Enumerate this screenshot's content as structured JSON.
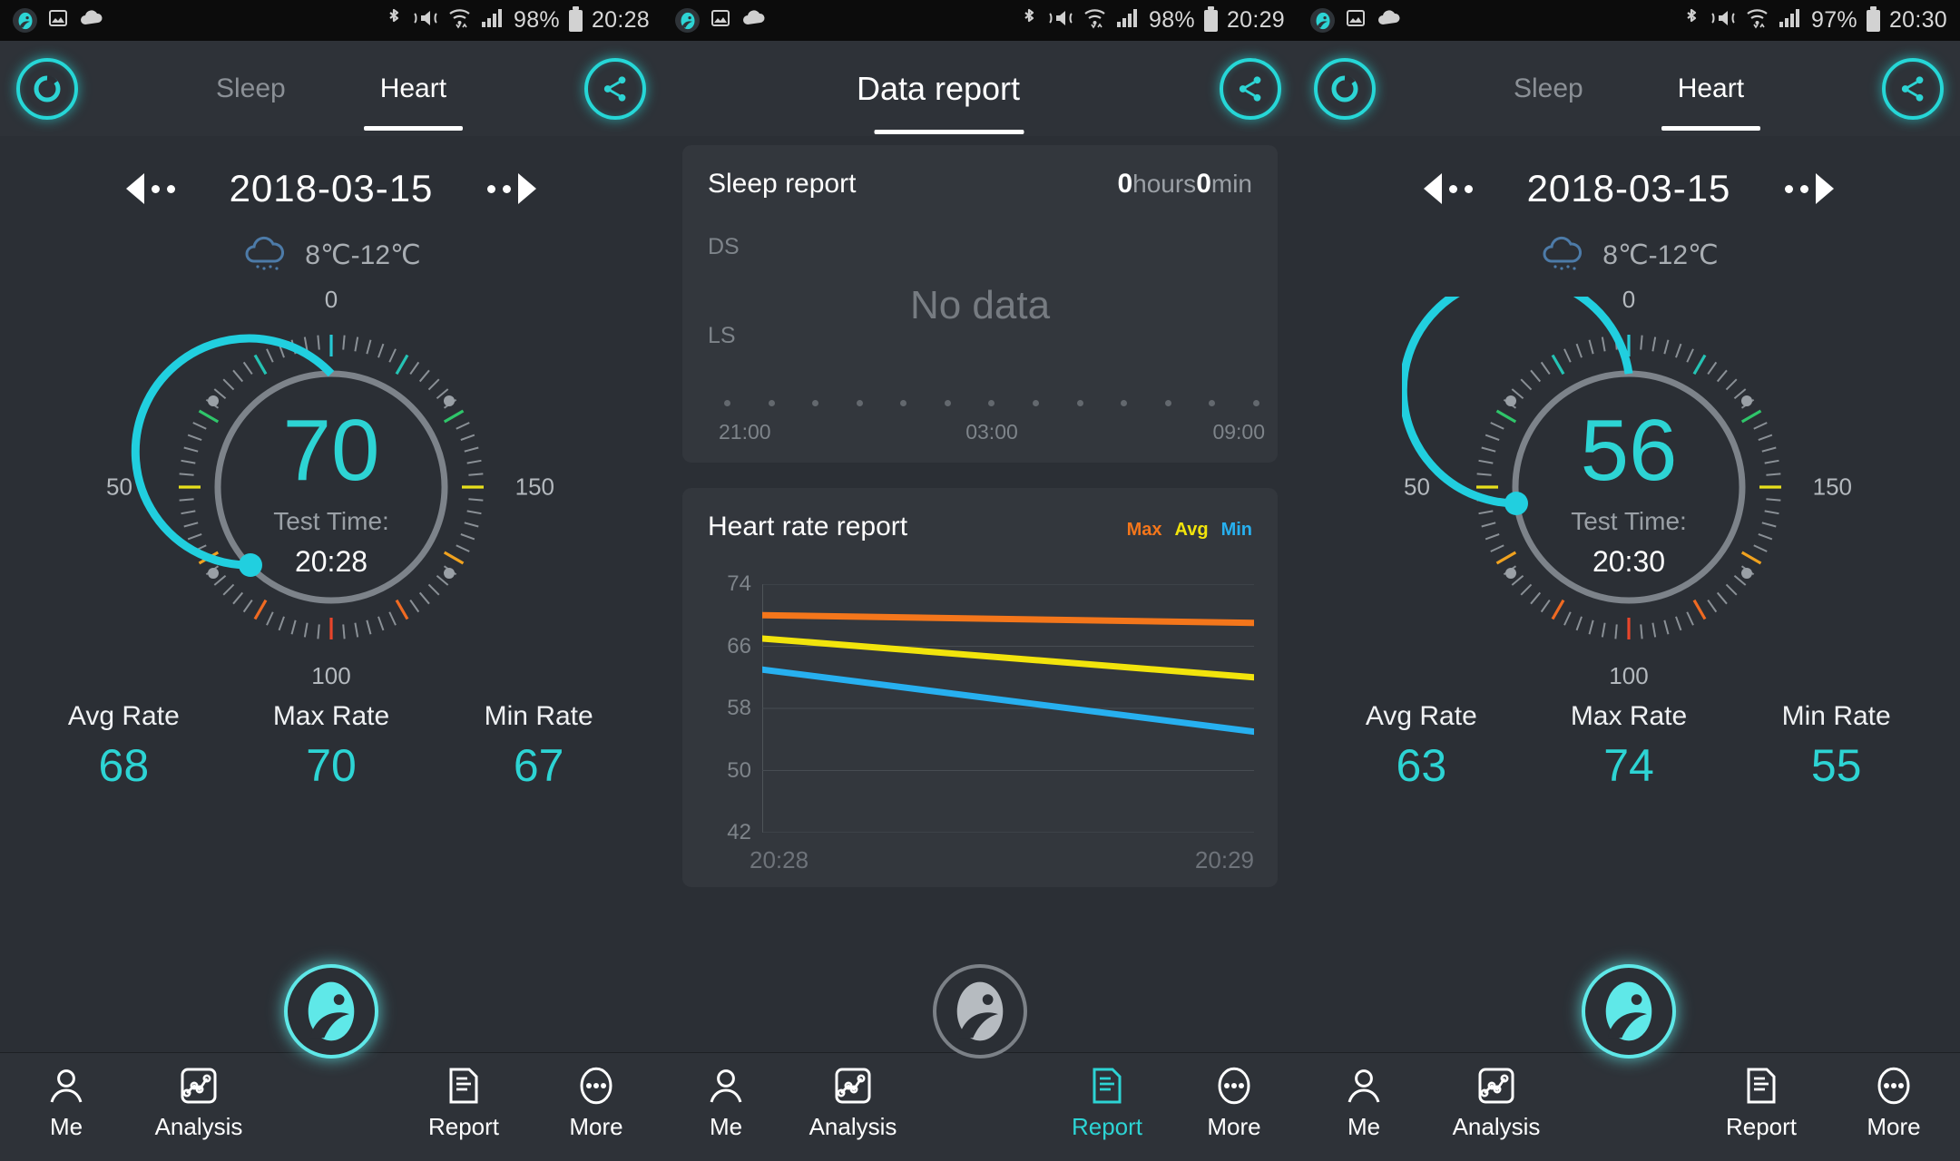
{
  "panels": [
    {
      "status": {
        "battery": "98%",
        "time": "20:28",
        "icons": [
          "app-logo-icon",
          "gallery-icon",
          "cloud-icon",
          "bluetooth-icon",
          "mute-vibrate-icon",
          "wifi-icon",
          "signal-icon",
          "battery-icon"
        ]
      },
      "header": {
        "logo": "ring-logo-icon",
        "tabs": [
          {
            "label": "Sleep",
            "active": false
          },
          {
            "label": "Heart",
            "active": true
          }
        ],
        "share": "share-icon"
      },
      "date": {
        "value": "2018-03-15",
        "prev": "prev-day",
        "next": "next-day"
      },
      "weather": {
        "icon": "rain-cloud-icon",
        "text": "8℃-12℃"
      },
      "gauge": {
        "value": "70",
        "test_time_label": "Test Time:",
        "test_time_value": "20:28",
        "scale": {
          "top": "0",
          "left": "50",
          "right": "150",
          "bottom": "100"
        },
        "percent": 70
      },
      "stats": [
        {
          "label": "Avg Rate",
          "value": "68"
        },
        {
          "label": "Max Rate",
          "value": "70"
        },
        {
          "label": "Min Rate",
          "value": "67"
        }
      ],
      "nav": {
        "items": [
          "Me",
          "Analysis",
          "Report",
          "More"
        ],
        "active": "",
        "fab": "cyan"
      }
    },
    {
      "status": {
        "battery": "98%",
        "time": "20:29"
      },
      "header": {
        "title": "Data report",
        "share": "share-icon"
      },
      "sleep_card": {
        "title": "Sleep report",
        "total_hours": "0",
        "hours_unit": "hours",
        "total_min": "0",
        "min_unit": "min",
        "y_labels": [
          "DS",
          "LS"
        ],
        "empty_text": "No data",
        "x_labels": [
          "21:00",
          "03:00",
          "09:00"
        ],
        "x_dot_count": 13
      },
      "hr_card": {
        "title": "Heart rate report",
        "legend": [
          {
            "label": "Max",
            "color": "#f4761b"
          },
          {
            "label": "Avg",
            "color": "#f2e40c"
          },
          {
            "label": "Min",
            "color": "#27b0f0"
          }
        ],
        "x_labels": [
          "20:28",
          "20:29"
        ]
      },
      "nav": {
        "items": [
          "Me",
          "Analysis",
          "Report",
          "More"
        ],
        "active": "Report",
        "fab": "gray"
      }
    },
    {
      "status": {
        "battery": "97%",
        "time": "20:30"
      },
      "header": {
        "logo": "ring-logo-icon",
        "tabs": [
          {
            "label": "Sleep",
            "active": false
          },
          {
            "label": "Heart",
            "active": true
          }
        ],
        "share": "share-icon"
      },
      "date": {
        "value": "2018-03-15"
      },
      "weather": {
        "icon": "rain-cloud-icon",
        "text": "8℃-12℃"
      },
      "gauge": {
        "value": "56",
        "test_time_label": "Test Time:",
        "test_time_value": "20:30",
        "scale": {
          "top": "0",
          "left": "50",
          "right": "150",
          "bottom": "100"
        },
        "percent": 56
      },
      "stats": [
        {
          "label": "Avg Rate",
          "value": "63"
        },
        {
          "label": "Max Rate",
          "value": "74"
        },
        {
          "label": "Min Rate",
          "value": "55"
        }
      ],
      "nav": {
        "items": [
          "Me",
          "Analysis",
          "Report",
          "More"
        ],
        "active": "",
        "fab": "cyan"
      }
    }
  ],
  "chart_data": {
    "type": "line",
    "title": "Heart rate report",
    "x": [
      "20:28",
      "20:29"
    ],
    "xlabel": "",
    "ylabel": "",
    "ylim": [
      42,
      74
    ],
    "yticks": [
      42,
      50,
      58,
      66,
      74
    ],
    "grid": true,
    "legend_position": "top-right",
    "series": [
      {
        "name": "Max",
        "color": "#f4761b",
        "values": [
          70,
          69
        ]
      },
      {
        "name": "Avg",
        "color": "#f2e40c",
        "values": [
          67,
          62
        ]
      },
      {
        "name": "Min",
        "color": "#27b0f0",
        "values": [
          63,
          55
        ]
      }
    ]
  },
  "colors": {
    "accent": "#2dd4d4",
    "background": "#2b2f35",
    "card": "#33373d",
    "statusbar": "#0c0c0c",
    "max_line": "#f4761b",
    "avg_line": "#f2e40c",
    "min_line": "#27b0f0",
    "gauge_track": "#7d838a"
  }
}
